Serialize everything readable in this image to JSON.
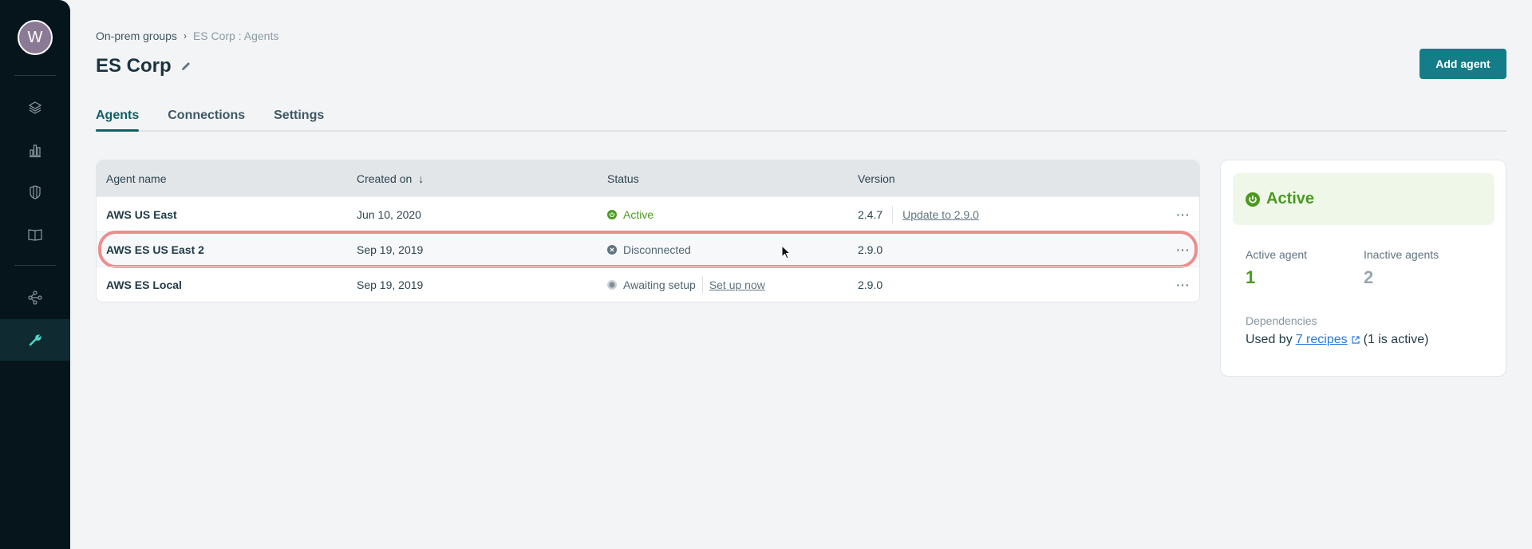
{
  "sidebar": {
    "avatar_initial": "W",
    "items": [
      {
        "name": "layers",
        "icon": "layers-icon"
      },
      {
        "name": "analytics",
        "icon": "bar-chart-icon"
      },
      {
        "name": "security",
        "icon": "shield-icon"
      },
      {
        "name": "docs",
        "icon": "book-icon"
      },
      {
        "name": "connections",
        "icon": "share-nodes-icon"
      },
      {
        "name": "tools",
        "icon": "wrench-icon",
        "active": true
      }
    ]
  },
  "breadcrumb": {
    "parent": "On-prem groups",
    "separator": "›",
    "current": "ES Corp : Agents"
  },
  "header": {
    "title": "ES Corp",
    "add_button": "Add agent"
  },
  "tabs": [
    {
      "label": "Agents",
      "active": true
    },
    {
      "label": "Connections"
    },
    {
      "label": "Settings"
    }
  ],
  "table": {
    "columns": [
      "Agent name",
      "Created on",
      "Status",
      "Version"
    ],
    "sort_indicator": "↓",
    "rows": [
      {
        "name": "AWS US East",
        "created": "Jun 10, 2020",
        "status": "Active",
        "version": "2.4.7",
        "version_action": "Update to 2.9.0",
        "menu": "···"
      },
      {
        "name": "AWS ES US East 2",
        "created": "Sep 19, 2019",
        "status": "Disconnected",
        "version": "2.9.0",
        "menu": "···"
      },
      {
        "name": "AWS ES Local",
        "created": "Sep 19, 2019",
        "status": "Awaiting setup",
        "status_action": "Set up now",
        "version": "2.9.0",
        "menu": "···"
      }
    ]
  },
  "summary": {
    "status": "Active",
    "active_label": "Active agent",
    "active_value": "1",
    "inactive_label": "Inactive agents",
    "inactive_value": "2",
    "dependencies_label": "Dependencies",
    "used_by_prefix": "Used by",
    "recipes_link": "7 recipes",
    "used_by_suffix": "(1 is active)"
  },
  "colors": {
    "accent": "#147d87",
    "active_green": "#4a9a1f",
    "highlight": "#ec8d8e",
    "sidebar_bg": "#06141c"
  }
}
